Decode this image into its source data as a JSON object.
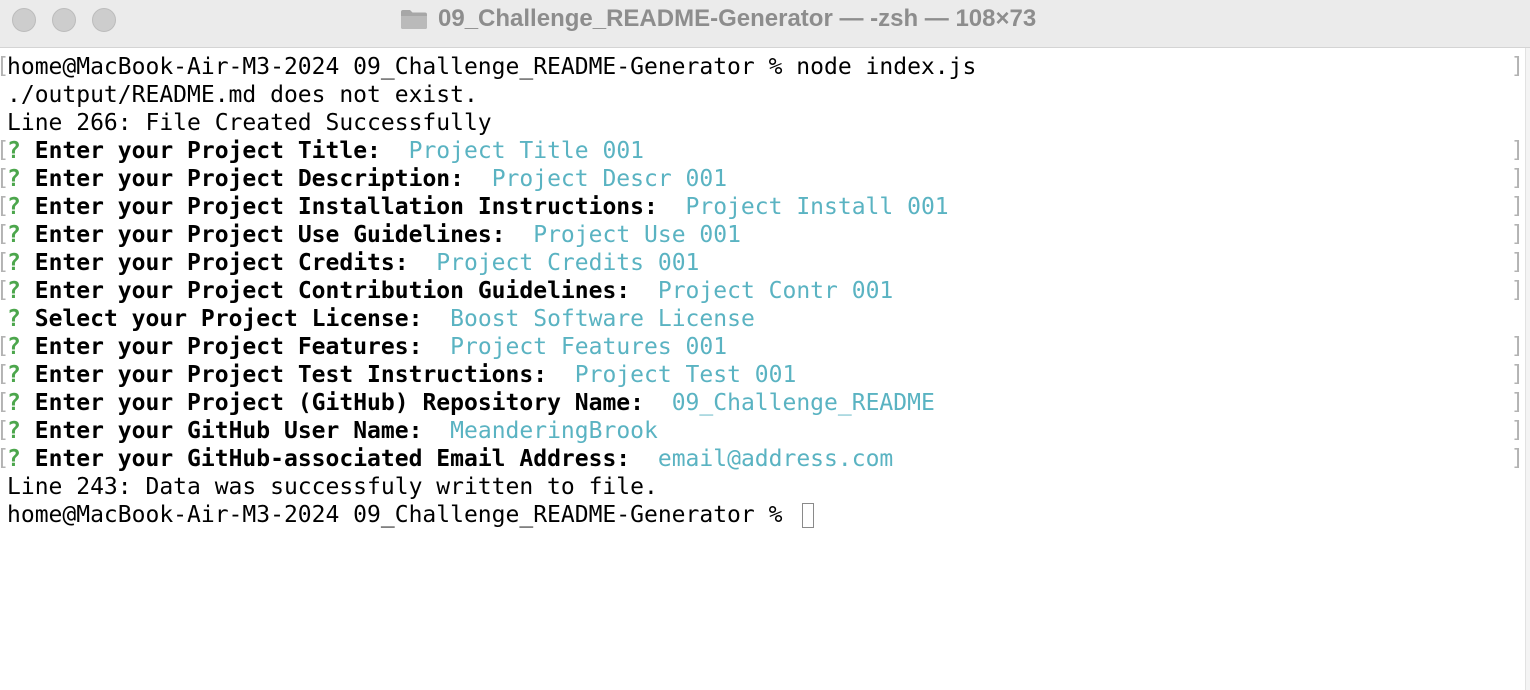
{
  "window": {
    "title": "09_Challenge_README-Generator — -zsh — 108×73",
    "icons": [
      "close-button",
      "minimize-button",
      "zoom-button",
      "folder-icon"
    ]
  },
  "terminal": {
    "command_line": {
      "prompt": "home@MacBook-Air-M3-2024 09_Challenge_README-Generator % ",
      "command": "node index.js"
    },
    "output_1": "./output/README.md does not exist.",
    "output_2": "Line 266: File Created Successfully",
    "questions": [
      {
        "marker": "?",
        "label": "Enter your Project Title:",
        "answer": "Project Title 001"
      },
      {
        "marker": "?",
        "label": "Enter your Project Description:",
        "answer": "Project Descr 001"
      },
      {
        "marker": "?",
        "label": "Enter your Project Installation Instructions:",
        "answer": "Project Install 001"
      },
      {
        "marker": "?",
        "label": "Enter your Project Use Guidelines:",
        "answer": "Project Use 001"
      },
      {
        "marker": "?",
        "label": "Enter your Project Credits:",
        "answer": "Project Credits 001"
      },
      {
        "marker": "?",
        "label": "Enter your Project Contribution Guidelines:",
        "answer": "Project Contr 001"
      },
      {
        "marker": "?",
        "label": "Select your Project License:",
        "answer": "Boost Software License"
      },
      {
        "marker": "?",
        "label": "Enter your Project Features:",
        "answer": "Project Features 001"
      },
      {
        "marker": "?",
        "label": "Enter your Project Test Instructions:",
        "answer": "Project Test 001"
      },
      {
        "marker": "?",
        "label": "Enter your Project (GitHub) Repository Name:",
        "answer": "09_Challenge_README"
      },
      {
        "marker": "?",
        "label": "Enter your GitHub User Name:",
        "answer": "MeanderingBrook"
      },
      {
        "marker": "?",
        "label": "Enter your GitHub-associated Email Address:",
        "answer": "email@address.com"
      }
    ],
    "output_3": "Line 243: Data was successfuly written to file.",
    "final_prompt": "home@MacBook-Air-M3-2024 09_Challenge_README-Generator % "
  },
  "colors": {
    "question_mark": "#4ca64c",
    "answer": "#5ab3c2",
    "titlebar_bg": "#ebebeb",
    "title_text": "#8d8d8d"
  }
}
